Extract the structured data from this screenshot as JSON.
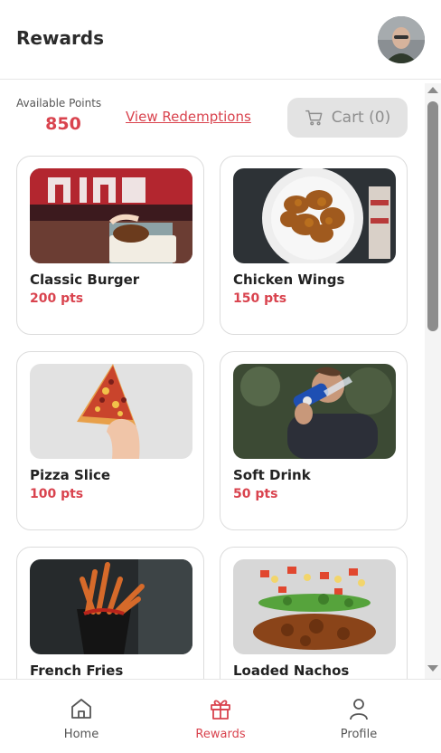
{
  "header": {
    "title": "Rewards",
    "avatar_icon": "user-photo"
  },
  "points": {
    "label": "Available Points",
    "value": "850"
  },
  "links": {
    "view_redemptions": "View Redemptions"
  },
  "cart": {
    "label": "Cart (0)",
    "icon": "cart-icon"
  },
  "items": [
    {
      "name": "Classic Burger",
      "points": "200 pts"
    },
    {
      "name": "Chicken Wings",
      "points": "150 pts"
    },
    {
      "name": "Pizza Slice",
      "points": "100 pts"
    },
    {
      "name": "Soft Drink",
      "points": "50 pts"
    },
    {
      "name": "French Fries",
      "points": ""
    },
    {
      "name": "Loaded Nachos",
      "points": ""
    }
  ],
  "nav": [
    {
      "label": "Home",
      "icon": "home-icon",
      "active": false
    },
    {
      "label": "Rewards",
      "icon": "gift-icon",
      "active": true
    },
    {
      "label": "Profile",
      "icon": "user-icon",
      "active": false
    }
  ],
  "colors": {
    "accent": "#d9434e",
    "muted": "#8e8e8e"
  }
}
